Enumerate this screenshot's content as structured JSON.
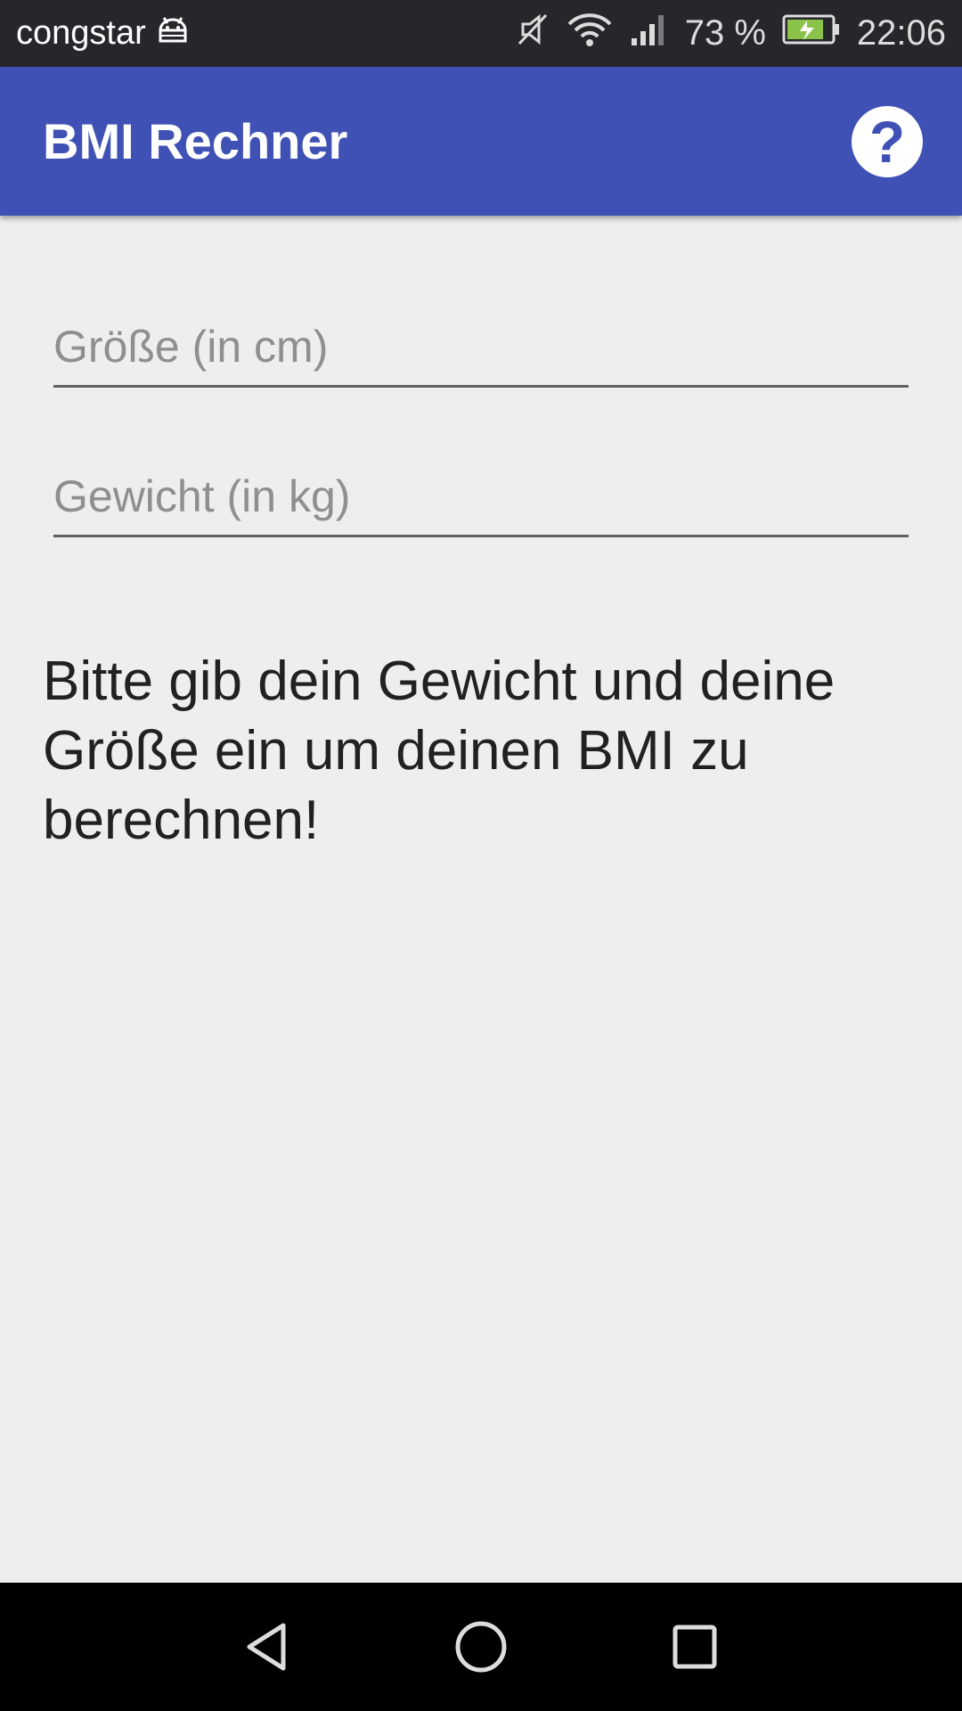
{
  "status_bar": {
    "carrier": "congstar",
    "battery_percent": "73 %",
    "time": "22:06",
    "icons": [
      "android-debug-icon",
      "mute-icon",
      "wifi-icon",
      "signal-icon",
      "battery-charging-icon"
    ]
  },
  "app_bar": {
    "title": "BMI Rechner",
    "help_icon": "help-icon",
    "color": "#3f51b5"
  },
  "form": {
    "height_placeholder": "Größe (in cm)",
    "weight_placeholder": "Gewicht (in kg)",
    "height_value": "",
    "weight_value": ""
  },
  "message": "Bitte gib dein Gewicht und deine Größe ein um deinen BMI zu berechnen!",
  "nav_bar": {
    "icons": [
      "back-icon",
      "home-icon",
      "recents-icon"
    ]
  }
}
